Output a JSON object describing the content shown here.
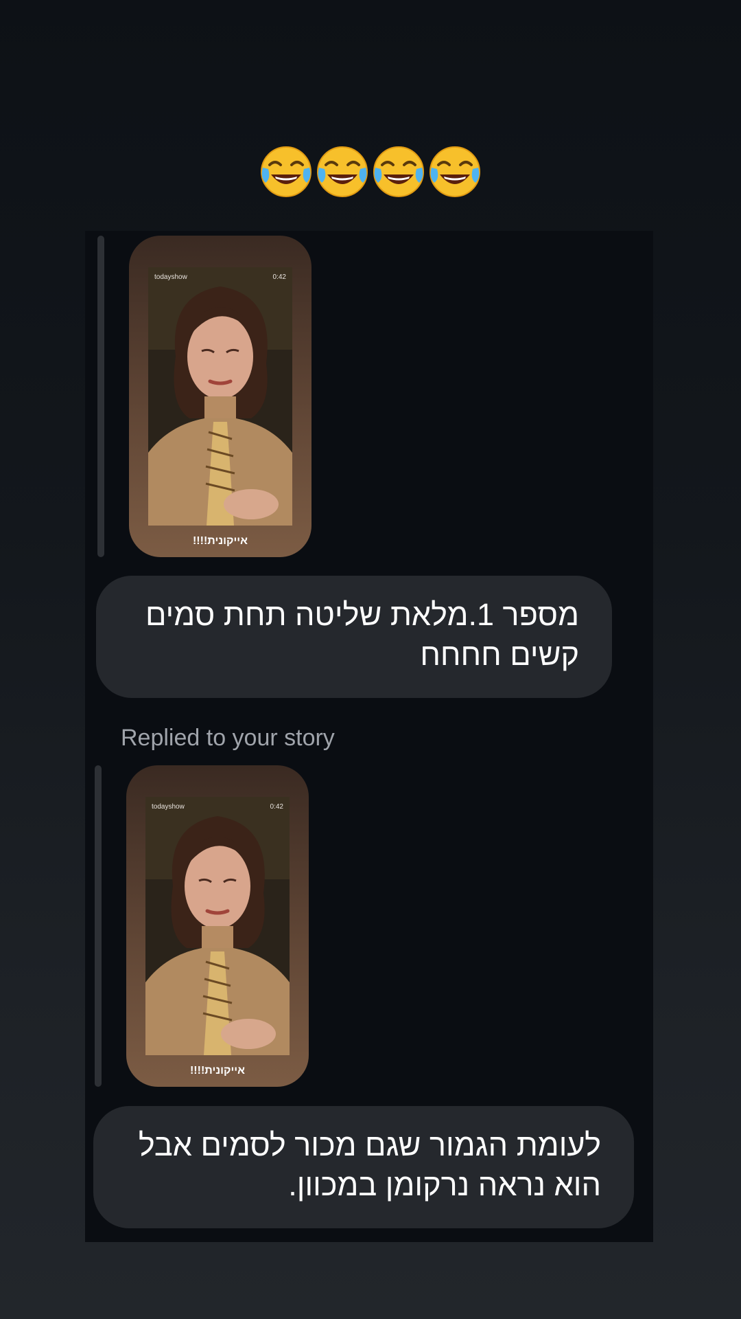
{
  "reaction": {
    "emojis": [
      "😂",
      "😂",
      "😂",
      "😂"
    ]
  },
  "messages": [
    {
      "story": {
        "source": "todayshow",
        "duration": "0:42",
        "caption": "אייקונית!!!!"
      },
      "text": "מספר 1.מלאת שליטה תחת סמים קשים חחחח"
    },
    {
      "label": "Replied to your story",
      "story": {
        "source": "todayshow",
        "duration": "0:42",
        "caption": "אייקונית!!!!"
      },
      "text": "לעומת הגמור שגם מכור לסמים אבל הוא נראה נרקומן במכוון."
    }
  ],
  "icons": {
    "reaction": "face-with-tears-of-joy-icon"
  },
  "colors": {
    "bubble": "#25282d",
    "panel": "#0a0d12",
    "label": "#a0a4ab",
    "story_frame": "#7c5c44"
  }
}
